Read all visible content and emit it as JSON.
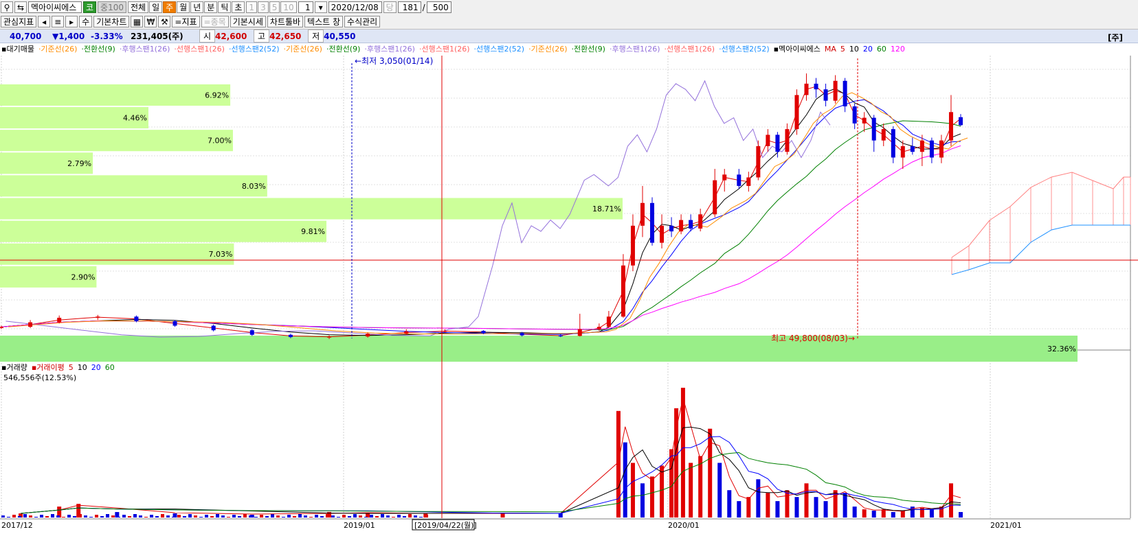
{
  "toolbar": {
    "stock_name": "멕아이씨에스",
    "market_badge": "코",
    "index_badge": "중100",
    "periods": [
      "전체",
      "일",
      "주",
      "월",
      "년",
      "분",
      "틱",
      "초"
    ],
    "selected_period": "주",
    "interval_buttons": [
      "1",
      "3",
      "5",
      "10"
    ],
    "interval_value": "1",
    "date_value": "2020/12/08",
    "dang_label": "당",
    "count_value": "181",
    "count_max": "500",
    "row2_buttons": [
      "관심지표",
      "기본차트",
      "지표",
      "종목",
      "기본시세",
      "차트툴바",
      "텍스트 창",
      "수식관리"
    ],
    "won_icon": "₩",
    "su_label": "수"
  },
  "quote": {
    "price": "40,700",
    "change": "▼1,400",
    "change_pct": "-3.33%",
    "volume": "231,405(주)",
    "open_label": "시",
    "open": "42,600",
    "high_label": "고",
    "high": "42,650",
    "low_label": "저",
    "low": "40,550",
    "unit_label": "[주]"
  },
  "legend_top": [
    {
      "text": "대기매물",
      "color": "#000000"
    },
    {
      "text": "기준선(26)",
      "color": "#ff8c00"
    },
    {
      "text": "전환선(9)",
      "color": "#008000"
    },
    {
      "text": "후행스팬1(26)",
      "color": "#9370db"
    },
    {
      "text": "선행스팬1(26)",
      "color": "#ff6060"
    },
    {
      "text": "선행스팬2(52)",
      "color": "#1e90ff"
    },
    {
      "text": "기준선(26)",
      "color": "#ff8c00"
    },
    {
      "text": "전환선(9)",
      "color": "#008000"
    },
    {
      "text": "후행스팬1(26)",
      "color": "#9370db"
    },
    {
      "text": "선행스팬1(26)",
      "color": "#ff6060"
    },
    {
      "text": "선행스팬2(52)",
      "color": "#1e90ff"
    },
    {
      "text": "기준선(26)",
      "color": "#ff8c00"
    },
    {
      "text": "전환선(9)",
      "color": "#008000"
    },
    {
      "text": "후행스팬1(26)",
      "color": "#9370db"
    },
    {
      "text": "선행스팬1(26)",
      "color": "#ff6060"
    },
    {
      "text": "선행스팬2(52)",
      "color": "#1e90ff"
    },
    {
      "text": "멕아이씨에스",
      "color": "#000000"
    },
    {
      "text": "MA",
      "color": "#d00000"
    },
    {
      "text": "5",
      "color": "#d00000"
    },
    {
      "text": "10",
      "color": "#000000"
    },
    {
      "text": "20",
      "color": "#0000ff"
    },
    {
      "text": "60",
      "color": "#008000"
    },
    {
      "text": "120",
      "color": "#ff00ff"
    }
  ],
  "legend_volume": [
    {
      "text": "거래량",
      "color": "#000000"
    },
    {
      "text": "거래이평",
      "color": "#d00000"
    },
    {
      "text": "5",
      "color": "#d00000"
    },
    {
      "text": "10",
      "color": "#000000"
    },
    {
      "text": "20",
      "color": "#0000ff"
    },
    {
      "text": "60",
      "color": "#008000"
    }
  ],
  "volume_readout": "546,556주(12.53%)",
  "annotations": {
    "min_label": "최저 3,050(01/14)",
    "max_label": "최고 49,800(08/03)",
    "cursor_date": "2019/04/22(월)"
  },
  "colors": {
    "up": "#e00000",
    "down": "#0000e0",
    "profile": "#ccff99",
    "profile_current": "#99ee88"
  },
  "chart_data": {
    "type": "candlestick",
    "x_ticks": [
      "2017/12",
      "2019/01",
      "2020/01",
      "2021/01"
    ],
    "volume_profile": [
      {
        "range": [
          44000,
          48000
        ],
        "pct": "6.92%",
        "value": 6.92
      },
      {
        "range": [
          40000,
          44000
        ],
        "pct": "4.46%",
        "value": 4.46
      },
      {
        "range": [
          36000,
          40000
        ],
        "pct": "7.00%",
        "value": 7.0
      },
      {
        "range": [
          32000,
          36000
        ],
        "pct": "2.79%",
        "value": 2.79
      },
      {
        "range": [
          28000,
          32000
        ],
        "pct": "8.03%",
        "value": 8.03
      },
      {
        "range": [
          24000,
          28000
        ],
        "pct": "18.71%",
        "value": 18.71
      },
      {
        "range": [
          20000,
          24000
        ],
        "pct": "9.81%",
        "value": 9.81
      },
      {
        "range": [
          16000,
          20000
        ],
        "pct": "7.03%",
        "value": 7.03
      },
      {
        "range": [
          12000,
          16000
        ],
        "pct": "2.90%",
        "value": 2.9
      },
      {
        "range": [
          3000,
          7000
        ],
        "pct": "32.36%",
        "value": 32.36
      }
    ],
    "price_range": [
      3050,
      49800
    ],
    "candles": [
      {
        "t": 0.0,
        "o": 5000,
        "c": 5200,
        "h": 5400,
        "l": 4800
      },
      {
        "t": 0.03,
        "o": 5200,
        "c": 6000,
        "h": 6400,
        "l": 5000
      },
      {
        "t": 0.06,
        "o": 6000,
        "c": 6800,
        "h": 7200,
        "l": 5800
      },
      {
        "t": 0.1,
        "o": 6800,
        "c": 7000,
        "h": 7300,
        "l": 6400
      },
      {
        "t": 0.14,
        "o": 7000,
        "c": 6200,
        "h": 7200,
        "l": 6000
      },
      {
        "t": 0.18,
        "o": 6200,
        "c": 5400,
        "h": 6400,
        "l": 5200
      },
      {
        "t": 0.22,
        "o": 5400,
        "c": 4600,
        "h": 5600,
        "l": 4400
      },
      {
        "t": 0.26,
        "o": 4600,
        "c": 3800,
        "h": 4800,
        "l": 3600
      },
      {
        "t": 0.3,
        "o": 3800,
        "c": 3400,
        "h": 4000,
        "l": 3200
      },
      {
        "t": 0.34,
        "o": 3400,
        "c": 3500,
        "h": 3700,
        "l": 3050
      },
      {
        "t": 0.38,
        "o": 3500,
        "c": 4000,
        "h": 4200,
        "l": 3300
      },
      {
        "t": 0.42,
        "o": 4000,
        "c": 4400,
        "h": 4800,
        "l": 3800
      },
      {
        "t": 0.46,
        "o": 4400,
        "c": 4500,
        "h": 4800,
        "l": 4200
      },
      {
        "t": 0.5,
        "o": 4500,
        "c": 4100,
        "h": 4600,
        "l": 3900
      },
      {
        "t": 0.54,
        "o": 4100,
        "c": 3700,
        "h": 4300,
        "l": 3500
      },
      {
        "t": 0.58,
        "o": 3700,
        "c": 3600,
        "h": 3900,
        "l": 3400
      },
      {
        "t": 0.6,
        "o": 3600,
        "c": 4800,
        "h": 7500,
        "l": 3500
      },
      {
        "t": 0.62,
        "o": 4800,
        "c": 5200,
        "h": 5800,
        "l": 4500
      },
      {
        "t": 0.63,
        "o": 5200,
        "c": 7000,
        "h": 8000,
        "l": 5000
      },
      {
        "t": 0.645,
        "o": 7000,
        "c": 16000,
        "h": 18000,
        "l": 6800
      },
      {
        "t": 0.655,
        "o": 16000,
        "c": 23000,
        "h": 25000,
        "l": 15000
      },
      {
        "t": 0.665,
        "o": 23000,
        "c": 27000,
        "h": 30000,
        "l": 21000
      },
      {
        "t": 0.675,
        "o": 27000,
        "c": 20000,
        "h": 28000,
        "l": 19500
      },
      {
        "t": 0.685,
        "o": 20000,
        "c": 23000,
        "h": 25000,
        "l": 19000
      },
      {
        "t": 0.695,
        "o": 23000,
        "c": 22000,
        "h": 24500,
        "l": 21000
      },
      {
        "t": 0.705,
        "o": 22000,
        "c": 24000,
        "h": 25000,
        "l": 21500
      },
      {
        "t": 0.715,
        "o": 24000,
        "c": 22500,
        "h": 25000,
        "l": 22000
      },
      {
        "t": 0.725,
        "o": 22500,
        "c": 25000,
        "h": 26000,
        "l": 22000
      },
      {
        "t": 0.74,
        "o": 25000,
        "c": 31000,
        "h": 33000,
        "l": 24500
      },
      {
        "t": 0.75,
        "o": 31000,
        "c": 32000,
        "h": 33000,
        "l": 29000
      },
      {
        "t": 0.765,
        "o": 32000,
        "c": 30000,
        "h": 33000,
        "l": 29500
      },
      {
        "t": 0.775,
        "o": 30000,
        "c": 31500,
        "h": 32500,
        "l": 29000
      },
      {
        "t": 0.785,
        "o": 31500,
        "c": 37000,
        "h": 38000,
        "l": 31000
      },
      {
        "t": 0.795,
        "o": 37000,
        "c": 39000,
        "h": 40000,
        "l": 36000
      },
      {
        "t": 0.805,
        "o": 39000,
        "c": 36000,
        "h": 39500,
        "l": 35000
      },
      {
        "t": 0.815,
        "o": 36000,
        "c": 40000,
        "h": 41000,
        "l": 35500
      },
      {
        "t": 0.825,
        "o": 40000,
        "c": 46000,
        "h": 47000,
        "l": 39000
      },
      {
        "t": 0.835,
        "o": 46000,
        "c": 48000,
        "h": 49800,
        "l": 45000
      },
      {
        "t": 0.845,
        "o": 48000,
        "c": 47000,
        "h": 49000,
        "l": 45500
      },
      {
        "t": 0.855,
        "o": 47000,
        "c": 45000,
        "h": 48000,
        "l": 44000
      },
      {
        "t": 0.865,
        "o": 45000,
        "c": 48500,
        "h": 49500,
        "l": 44500
      },
      {
        "t": 0.875,
        "o": 48500,
        "c": 44000,
        "h": 49000,
        "l": 43000
      },
      {
        "t": 0.885,
        "o": 44000,
        "c": 41000,
        "h": 44500,
        "l": 40000
      },
      {
        "t": 0.895,
        "o": 41000,
        "c": 42000,
        "h": 43000,
        "l": 39500
      },
      {
        "t": 0.905,
        "o": 42000,
        "c": 38000,
        "h": 42500,
        "l": 36000
      },
      {
        "t": 0.915,
        "o": 38000,
        "c": 40000,
        "h": 41000,
        "l": 37000
      },
      {
        "t": 0.925,
        "o": 40000,
        "c": 35000,
        "h": 40500,
        "l": 34000
      },
      {
        "t": 0.935,
        "o": 35000,
        "c": 37000,
        "h": 38000,
        "l": 33000
      },
      {
        "t": 0.945,
        "o": 37000,
        "c": 36000,
        "h": 38500,
        "l": 35500
      },
      {
        "t": 0.955,
        "o": 36000,
        "c": 38000,
        "h": 39000,
        "l": 33500
      },
      {
        "t": 0.965,
        "o": 38000,
        "c": 35000,
        "h": 38500,
        "l": 34000
      },
      {
        "t": 0.975,
        "o": 35000,
        "c": 38000,
        "h": 39000,
        "l": 34000
      },
      {
        "t": 0.985,
        "o": 38000,
        "c": 43000,
        "h": 46000,
        "l": 37000
      },
      {
        "t": 0.995,
        "o": 42100,
        "c": 40700,
        "h": 42650,
        "l": 40550
      }
    ],
    "volumes": [
      {
        "t": 0.02,
        "v": 3,
        "up": true
      },
      {
        "t": 0.06,
        "v": 8,
        "up": true
      },
      {
        "t": 0.08,
        "v": 10,
        "up": true
      },
      {
        "t": 0.12,
        "v": 4,
        "up": false
      },
      {
        "t": 0.18,
        "v": 3,
        "up": false
      },
      {
        "t": 0.26,
        "v": 2,
        "up": false
      },
      {
        "t": 0.34,
        "v": 4,
        "up": true
      },
      {
        "t": 0.38,
        "v": 3,
        "up": true
      },
      {
        "t": 0.44,
        "v": 3,
        "up": true
      },
      {
        "t": 0.52,
        "v": 3,
        "up": true
      },
      {
        "t": 0.58,
        "v": 3,
        "up": false
      },
      {
        "t": 0.64,
        "v": 78,
        "up": true
      },
      {
        "t": 0.647,
        "v": 55,
        "up": false
      },
      {
        "t": 0.655,
        "v": 40,
        "up": true
      },
      {
        "t": 0.665,
        "v": 25,
        "up": false
      },
      {
        "t": 0.675,
        "v": 30,
        "up": true
      },
      {
        "t": 0.685,
        "v": 38,
        "up": true
      },
      {
        "t": 0.695,
        "v": 50,
        "up": true
      },
      {
        "t": 0.7,
        "v": 80,
        "up": true
      },
      {
        "t": 0.707,
        "v": 95,
        "up": true
      },
      {
        "t": 0.715,
        "v": 40,
        "up": true
      },
      {
        "t": 0.725,
        "v": 45,
        "up": true
      },
      {
        "t": 0.735,
        "v": 65,
        "up": true
      },
      {
        "t": 0.745,
        "v": 40,
        "up": false
      },
      {
        "t": 0.755,
        "v": 20,
        "up": false
      },
      {
        "t": 0.765,
        "v": 12,
        "up": false
      },
      {
        "t": 0.775,
        "v": 15,
        "up": true
      },
      {
        "t": 0.785,
        "v": 28,
        "up": false
      },
      {
        "t": 0.795,
        "v": 18,
        "up": true
      },
      {
        "t": 0.805,
        "v": 12,
        "up": false
      },
      {
        "t": 0.815,
        "v": 20,
        "up": true
      },
      {
        "t": 0.825,
        "v": 15,
        "up": false
      },
      {
        "t": 0.835,
        "v": 25,
        "up": true
      },
      {
        "t": 0.845,
        "v": 15,
        "up": false
      },
      {
        "t": 0.855,
        "v": 12,
        "up": false
      },
      {
        "t": 0.865,
        "v": 20,
        "up": true
      },
      {
        "t": 0.875,
        "v": 18,
        "up": false
      },
      {
        "t": 0.885,
        "v": 8,
        "up": false
      },
      {
        "t": 0.895,
        "v": 6,
        "up": true
      },
      {
        "t": 0.905,
        "v": 5,
        "up": false
      },
      {
        "t": 0.915,
        "v": 6,
        "up": true
      },
      {
        "t": 0.925,
        "v": 4,
        "up": false
      },
      {
        "t": 0.935,
        "v": 5,
        "up": true
      },
      {
        "t": 0.945,
        "v": 8,
        "up": false
      },
      {
        "t": 0.955,
        "v": 7,
        "up": true
      },
      {
        "t": 0.965,
        "v": 6,
        "up": false
      },
      {
        "t": 0.975,
        "v": 8,
        "up": true
      },
      {
        "t": 0.985,
        "v": 25,
        "up": true
      },
      {
        "t": 0.995,
        "v": 4,
        "up": false
      }
    ],
    "volume_range": [
      0,
      100
    ],
    "grid": true
  }
}
